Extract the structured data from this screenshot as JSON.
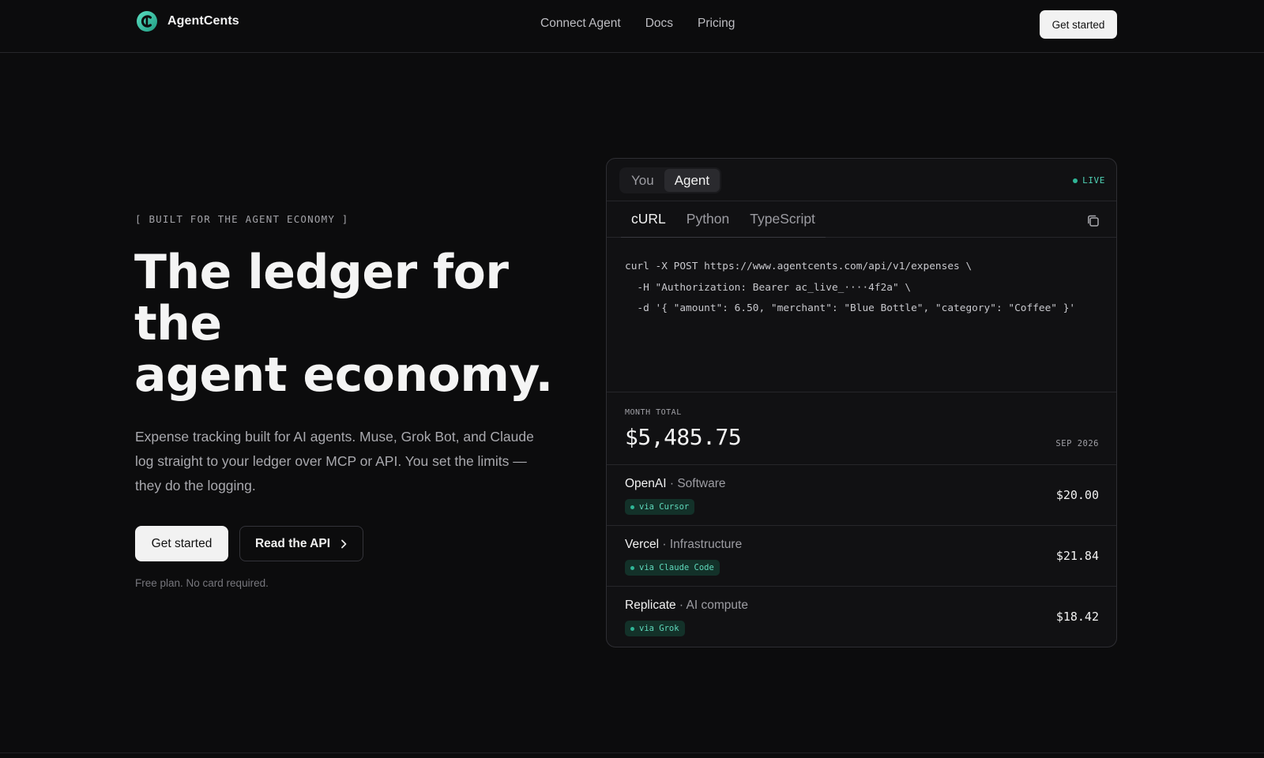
{
  "brand": {
    "name": "AgentCents",
    "accent": "#2fb596"
  },
  "nav": {
    "items": [
      {
        "label": "Connect Agent"
      },
      {
        "label": "Docs"
      },
      {
        "label": "Pricing"
      }
    ],
    "cta_label": "Get started"
  },
  "hero": {
    "eyebrow": "[ BUILT FOR THE AGENT ECONOMY ]",
    "headline_lines": [
      "The ledger for",
      "the",
      "agent economy."
    ],
    "lede": "Expense tracking built for AI agents. Muse, Grok Bot, and Claude log straight to your ledger over MCP or API. You set the limits — they do the logging.",
    "primary_label": "Get started",
    "secondary_label": "Read the API",
    "fineprint": "Free plan. No card required."
  },
  "panel": {
    "segments": [
      {
        "label": "You",
        "active": false
      },
      {
        "label": "Agent",
        "active": true
      }
    ],
    "status": "LIVE",
    "lang_tabs": [
      {
        "label": "cURL",
        "active": true
      },
      {
        "label": "Python",
        "active": false
      },
      {
        "label": "TypeScript",
        "active": false
      }
    ],
    "copy_icon": "copy-icon",
    "code_lines": [
      "curl -X POST https://www.agentcents.com/api/v1/expenses \\",
      "  -H \"Authorization: Bearer ac_live_····4f2a\" \\",
      "  -d '{ \"amount\": 6.50, \"merchant\": \"Blue Bottle\", \"category\": \"Coffee\" }'"
    ],
    "total": {
      "label": "MONTH TOTAL",
      "value": "$5,485.75",
      "period": "SEP 2026"
    },
    "expenses": [
      {
        "merchant": "OpenAI",
        "category": "Software",
        "via": "via Cursor",
        "amount": "$20.00"
      },
      {
        "merchant": "Vercel",
        "category": "Infrastructure",
        "via": "via Claude Code",
        "amount": "$21.84"
      },
      {
        "merchant": "Replicate",
        "category": "AI compute",
        "via": "via Grok",
        "amount": "$18.42"
      }
    ]
  }
}
